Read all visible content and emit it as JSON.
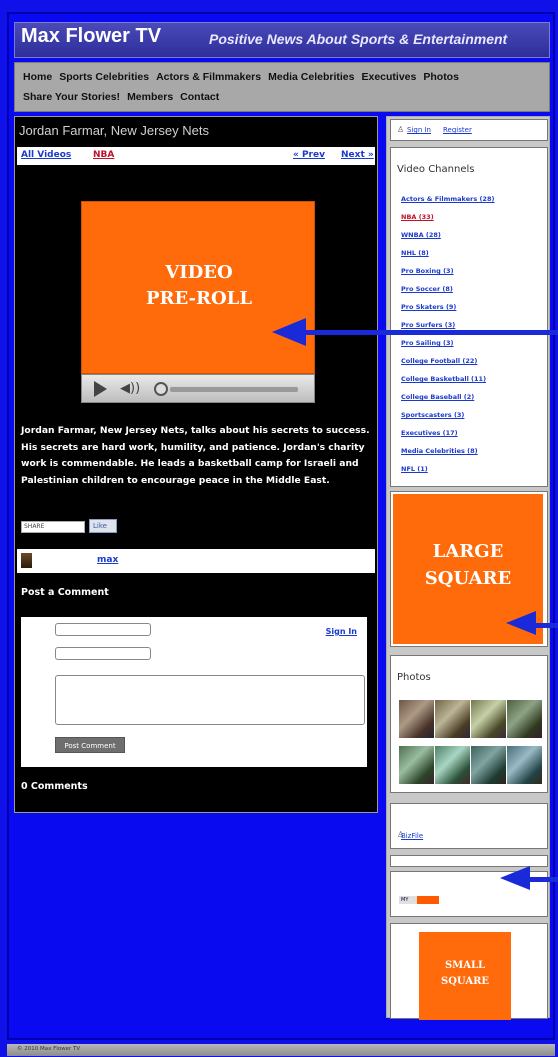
{
  "header": {
    "site_title": "Max Flower TV",
    "tagline": "Positive News About Sports & Entertainment"
  },
  "nav": {
    "row1": [
      "Home",
      "Sports Celebrities",
      "Actors & Filmmakers",
      "Media Celebrities",
      "Executives",
      "Photos"
    ],
    "row2": [
      "Share Your Stories!",
      "Members",
      "Contact"
    ]
  },
  "video": {
    "title": "Jordan Farmar, New Jersey Nets",
    "links": {
      "all_videos": "All Videos",
      "category": "NBA",
      "prev": "« Prev",
      "next": "Next »"
    },
    "preroll_label": "VIDEO\nPRE-ROLL",
    "description": "Jordan Farmar, New Jersey Nets, talks about his secrets to success.  His secrets are hard work, humility, and patience.  Jordan's charity work is commendable.  He leads a basketball camp for Israeli and Palestinian children to encourage peace in the Middle East.",
    "share_label": "SHARE",
    "like_label": "Like",
    "author": "max"
  },
  "comments": {
    "heading": "Post a Comment",
    "sign_in": "Sign In",
    "post_button": "Post Comment",
    "count_text": "0 Comments"
  },
  "sidebar": {
    "sign_in": "Sign In",
    "register": "Register",
    "channels_heading": "Video Channels",
    "channels": [
      "Actors & Filmmakers (28)",
      "NBA (33)",
      "WNBA (28)",
      "NHL (8)",
      "Pro Boxing (3)",
      "Pro Soccer (8)",
      "Pro Skaters (9)",
      "Pro Surfers (3)",
      "Pro Sailing (3)",
      "College Football (22)",
      "College Basketball (11)",
      "College Baseball (2)",
      "Sportscasters (3)",
      "Executives (17)",
      "Media Celebrities (8)",
      "NFL (1)"
    ],
    "active_channel": "NBA (33)",
    "large_square_label": "LARGE\nSQUARE",
    "photos_heading": "Photos",
    "photo_count": 8,
    "bizfile_link": "BizFile",
    "myspace_badge": "MY",
    "small_square_label": "SMALL\nSQUARE"
  },
  "footer": {
    "text": "© 2010 Max Flower TV"
  },
  "colors": {
    "background": "#1010e8",
    "ad_orange": "#ff6a0a",
    "arrow_blue": "#1a2ad8",
    "link_blue": "#1a3acc",
    "active_red": "#c0102a"
  }
}
